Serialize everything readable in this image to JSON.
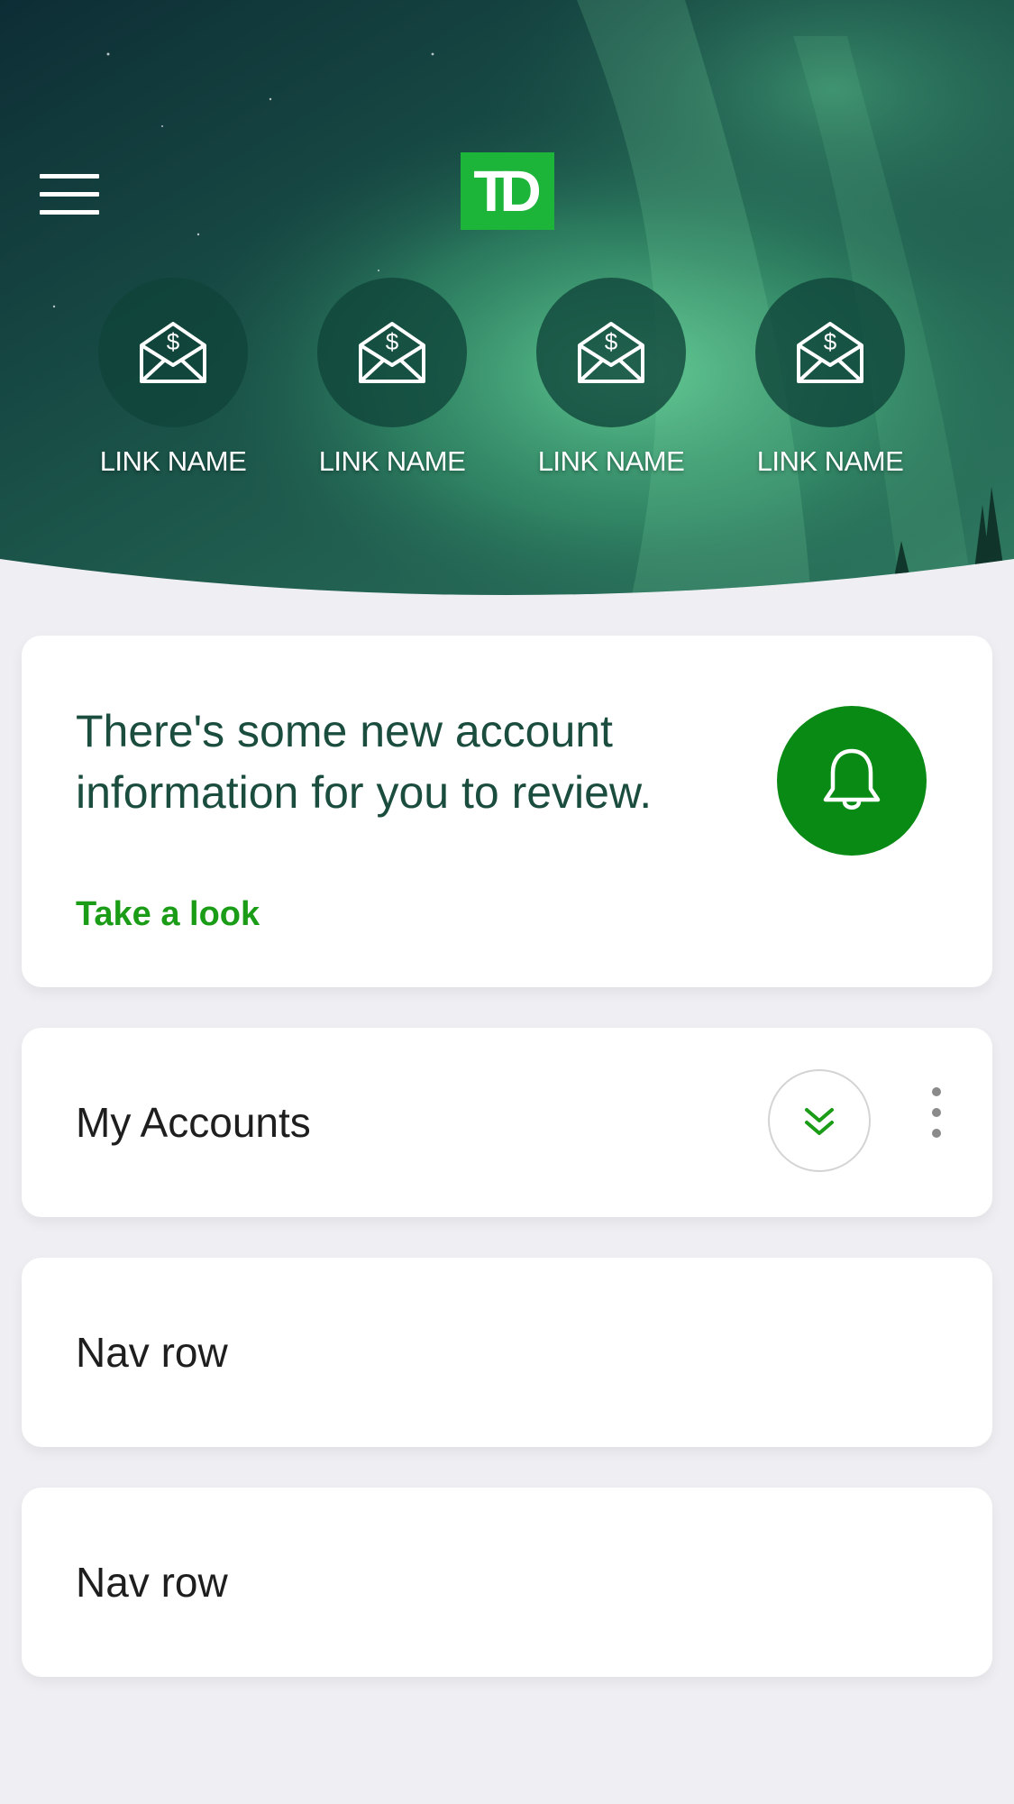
{
  "header": {
    "logo_text": "TD",
    "menu_icon": "hamburger-menu-icon",
    "quick_links": [
      {
        "label": "LINK NAME",
        "icon": "envelope-dollar-icon"
      },
      {
        "label": "LINK NAME",
        "icon": "envelope-dollar-icon"
      },
      {
        "label": "LINK NAME",
        "icon": "envelope-dollar-icon"
      },
      {
        "label": "LINK NAME",
        "icon": "envelope-dollar-icon"
      }
    ]
  },
  "alert": {
    "message": "There's some new account information for you to review.",
    "link_label": "Take a look",
    "icon": "bell-icon"
  },
  "accounts": {
    "title": "My Accounts",
    "expand_icon": "double-chevron-down-icon",
    "more_icon": "kebab-menu-icon"
  },
  "nav_rows": [
    {
      "label": "Nav row"
    },
    {
      "label": "Nav row"
    }
  ],
  "colors": {
    "brand_green": "#1db43a",
    "accent_green": "#088a14",
    "text_dark_green": "#1b4d3e",
    "background": "#efeff3"
  }
}
